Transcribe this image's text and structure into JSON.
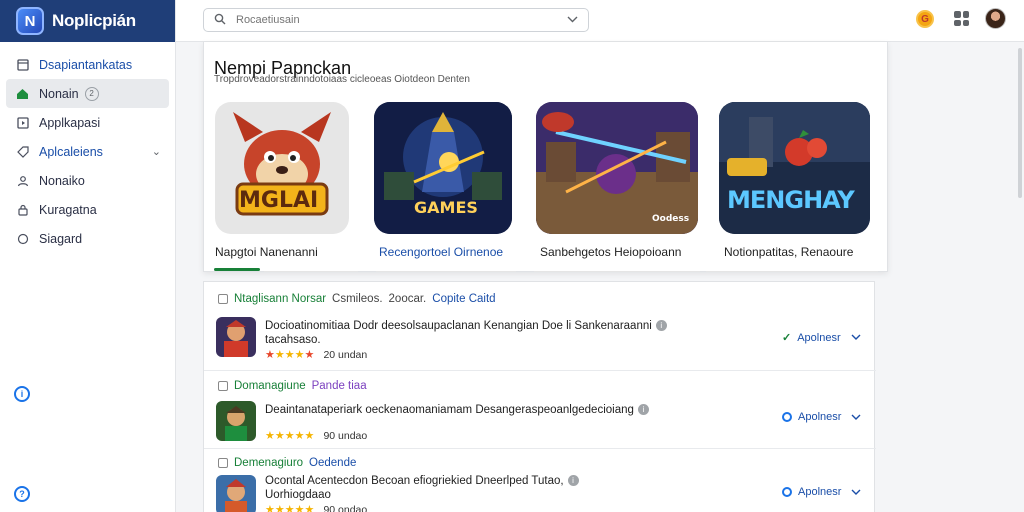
{
  "app": {
    "title": "Noplicpián",
    "logo_glyph": "N"
  },
  "sidebar": {
    "items": [
      {
        "label": "Dsapiantankatas",
        "icon": "window-icon"
      },
      {
        "label": "Nonain",
        "icon": "home-icon",
        "badge": "2"
      },
      {
        "label": "Applkapasi",
        "icon": "app-icon"
      },
      {
        "label": "Aplcaleiens",
        "icon": "tag-icon"
      },
      {
        "label": "Nonaiko",
        "icon": "person-icon"
      },
      {
        "label": "Kuragatna",
        "icon": "lock-icon"
      },
      {
        "label": "Siagard",
        "icon": "circle-icon"
      }
    ],
    "bottom_icons": [
      "info-icon",
      "help-icon"
    ]
  },
  "topbar": {
    "search_placeholder": "Rocaetiusain",
    "coin_glyph": "G"
  },
  "featured": {
    "title": "Nempi Papnckan",
    "subtitle": "Tropdroveadorstrainndotoiaas cicleoeas Oiotdeon Denten",
    "tiles": [
      {
        "label": "Napgtoi Nanenanni",
        "art_text": "MGLAI"
      },
      {
        "label": "Recengortoel Oirnenoe",
        "art_text": "GAMES"
      },
      {
        "label": "Sanbehgetos Heiopoioann",
        "art_text": "Oodess"
      },
      {
        "label": "Notionpatitas, Renaoure",
        "art_text": "MENGHAY"
      }
    ]
  },
  "list": {
    "rows": [
      {
        "head": [
          "Ntaglisann Norsar",
          "Csmileos.",
          "2oocar.",
          "Copite Caitd"
        ],
        "desc_line1": "Docioatinomitiaa Dodr deesolsaupaclanan Kenangian Doe li Sankenaraanni",
        "desc_line2": "tacahsaso.",
        "rating_count": "20 undan",
        "action": "Apolnesr"
      },
      {
        "head": [
          "Domanagiune",
          "Pande tiaa"
        ],
        "desc_line1": "Deaintanataperiark oeckenaomaniamam Desangeraspeoanlgedecioiang",
        "desc_line2": "",
        "rating_count": "90 undao",
        "action": "Apolnesr"
      },
      {
        "head": [
          "Demenagiuro",
          "Oedende"
        ],
        "desc_line1": "Ocontal Acentecdon Becoan efiogriekied Dneerlped Tutao,",
        "desc_line2": "Uorhiogdaao",
        "rating_count": "90 ondao",
        "action": "Apolnesr"
      }
    ]
  },
  "colors": {
    "brand": "#1f3e78",
    "accent_green": "#188038",
    "accent_blue": "#1a4ea8",
    "star": "#f5b400"
  }
}
